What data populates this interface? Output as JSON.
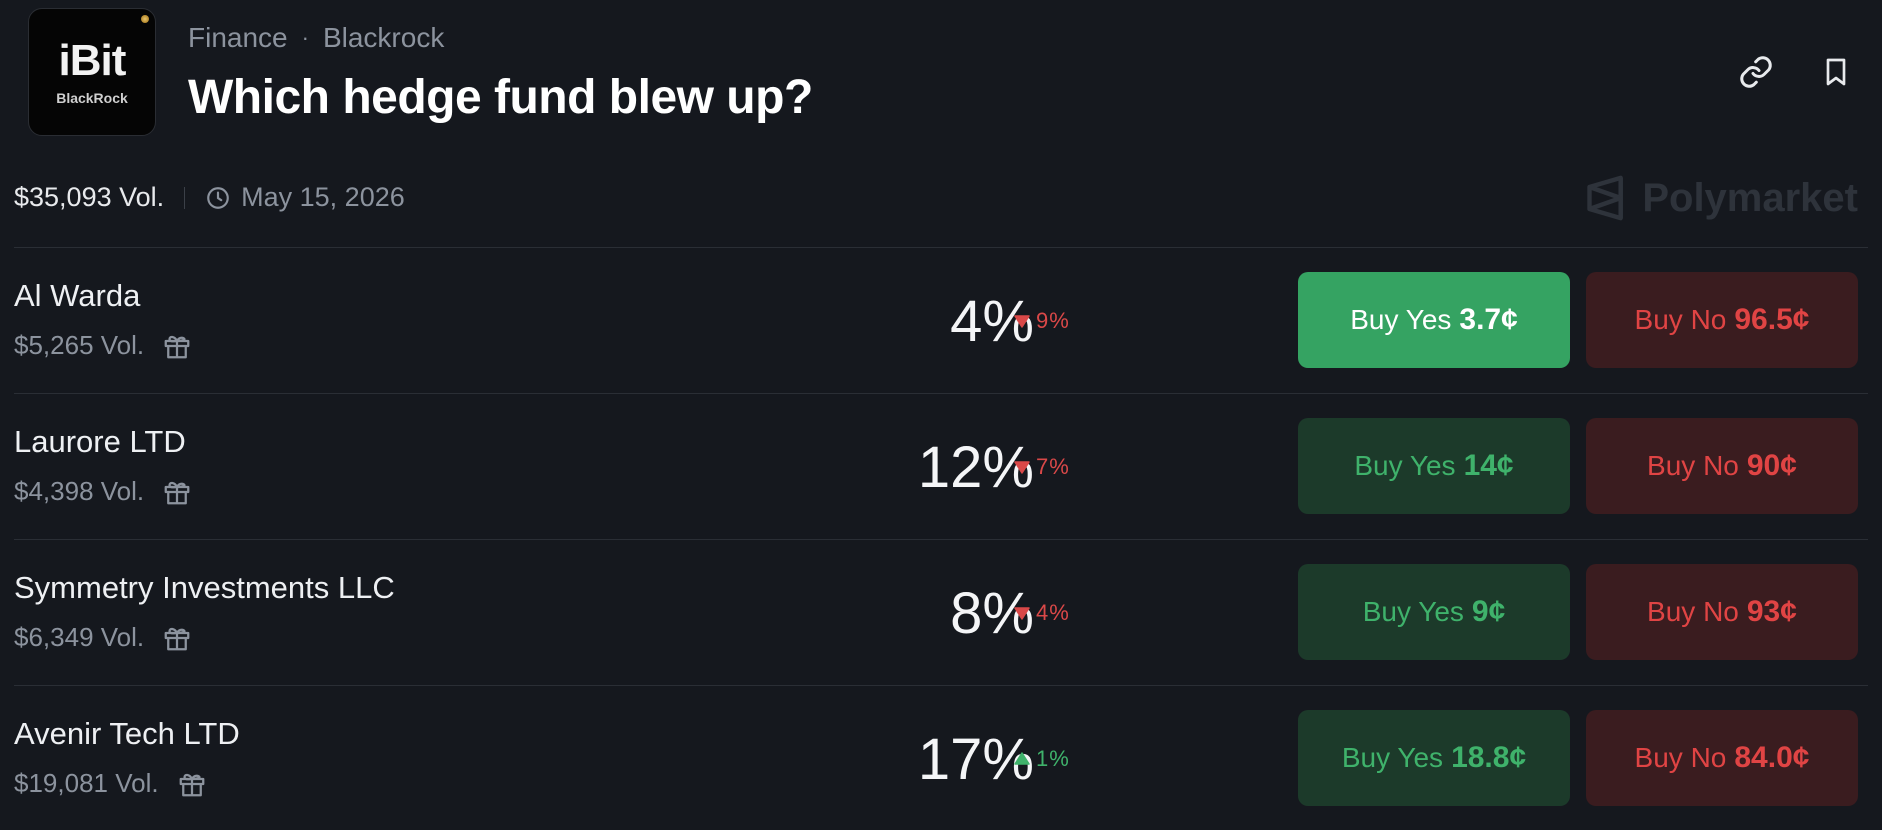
{
  "header": {
    "logo_main": "iBit",
    "logo_sub": "BlackRock",
    "category": "Finance",
    "subcategory": "Blackrock",
    "separator": "·",
    "title": "Which hedge fund blew up?"
  },
  "meta": {
    "volume": "$35,093 Vol.",
    "date": "May 15, 2026",
    "brand": "Polymarket"
  },
  "outcomes": [
    {
      "name": "Al Warda",
      "volume": "$5,265 Vol.",
      "percent": "4%",
      "change": "9%",
      "direction": "down",
      "yes_label": "Buy Yes",
      "yes_price": "3.7¢",
      "no_label": "Buy No",
      "no_price": "96.5¢"
    },
    {
      "name": "Laurore LTD",
      "volume": "$4,398 Vol.",
      "percent": "12%",
      "change": "7%",
      "direction": "down",
      "yes_label": "Buy Yes",
      "yes_price": "14¢",
      "no_label": "Buy No",
      "no_price": "90¢"
    },
    {
      "name": "Symmetry Investments LLC",
      "volume": "$6,349 Vol.",
      "percent": "8%",
      "change": "4%",
      "direction": "down",
      "yes_label": "Buy Yes",
      "yes_price": "9¢",
      "no_label": "Buy No",
      "no_price": "93¢"
    },
    {
      "name": "Avenir Tech LTD",
      "volume": "$19,081 Vol.",
      "percent": "17%",
      "change": "1%",
      "direction": "up",
      "yes_label": "Buy Yes",
      "yes_price": "18.8¢",
      "no_label": "Buy No",
      "no_price": "84.0¢"
    }
  ],
  "colors": {
    "background": "#15181e",
    "yes_active": "#35a362",
    "yes": "#1c3a2a",
    "no": "#3a1c1f",
    "down": "#d94848",
    "up": "#3fb26b"
  },
  "icons": {
    "link": "link-icon",
    "bookmark": "bookmark-icon",
    "clock": "clock-icon",
    "gift": "gift-icon",
    "brand": "polymarket-logo-icon"
  }
}
